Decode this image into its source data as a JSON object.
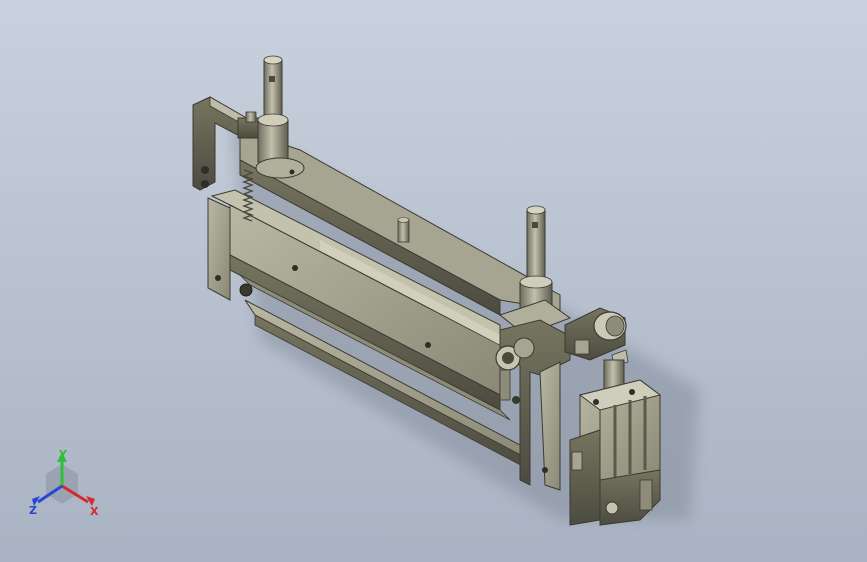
{
  "viewport": {
    "background_top": "#c9d1de",
    "background_bottom": "#aab3c3"
  },
  "model": {
    "type": "isometric CAD assembly",
    "metal_color": "#9a9883",
    "metal_dark": "#55544a",
    "metal_light": "#c5c4b0"
  },
  "triad": {
    "y_label": "Y",
    "z_label": "Z",
    "x_label": "X",
    "y_color": "#2fbf3a",
    "z_color": "#2747d6",
    "x_color": "#d42a2a"
  }
}
